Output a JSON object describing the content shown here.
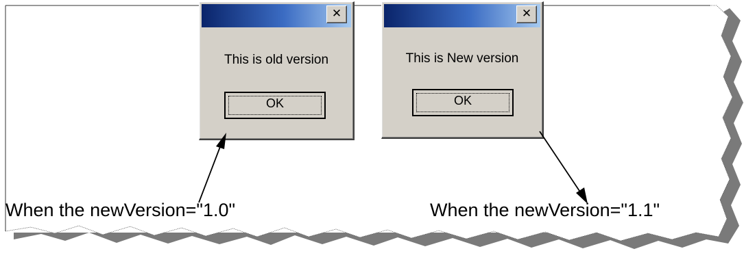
{
  "dialogs": [
    {
      "message": "This is old version",
      "ok_label": "OK",
      "close_glyph": "✕"
    },
    {
      "message": "This is New version",
      "ok_label": "OK",
      "close_glyph": "✕"
    }
  ],
  "captions": {
    "left": "When the newVersion=\"1.0\"",
    "right": "When the newVersion=\"1.1\""
  },
  "colors": {
    "dialog_face": "#d4d0c8",
    "titlebar_start": "#0a246a",
    "titlebar_end": "#a6caf0",
    "shadow": "#6e6e6e"
  }
}
